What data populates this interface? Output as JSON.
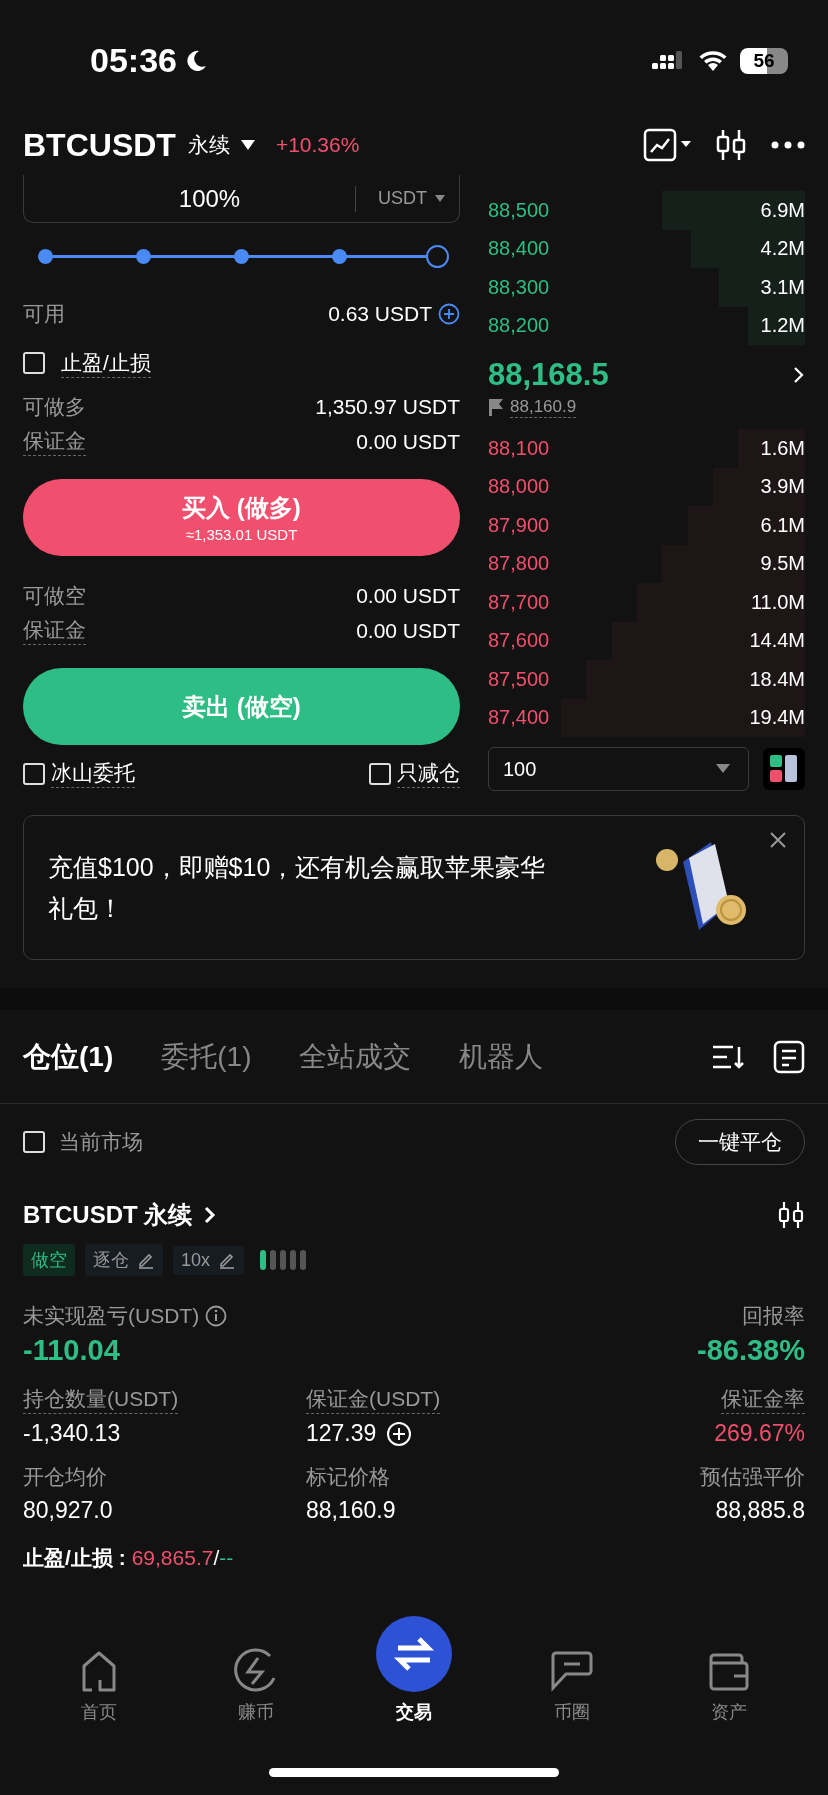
{
  "status_bar": {
    "time": "05:36",
    "battery": "56"
  },
  "header": {
    "symbol": "BTCUSDT",
    "contract": "永续",
    "change": "+10.36%"
  },
  "order_form": {
    "amount": {
      "value": "100%",
      "unit": "USDT"
    },
    "slider": {
      "level": 1
    },
    "available": {
      "label": "可用",
      "value": "0.63 USDT"
    },
    "tp_sl": {
      "label": "止盈/止损",
      "checked": false
    },
    "long_rows": [
      {
        "label": "可做多",
        "value": "1,350.97 USDT"
      },
      {
        "label": "保证金",
        "value": "0.00 USDT"
      }
    ],
    "buy_button": {
      "label": "买入 (做多)",
      "sub": "≈1,353.01 USDT"
    },
    "short_rows": [
      {
        "label": "可做空",
        "value": "0.00 USDT"
      },
      {
        "label": "保证金",
        "value": "0.00 USDT"
      }
    ],
    "sell_button": {
      "label": "卖出 (做空)"
    },
    "options": [
      {
        "label": "冰山委托",
        "checked": false
      },
      {
        "label": "只减仓",
        "checked": false
      }
    ]
  },
  "order_book": {
    "asks": [
      {
        "price": "88,500",
        "size": "6.9M"
      },
      {
        "price": "88,400",
        "size": "4.2M"
      },
      {
        "price": "88,300",
        "size": "3.1M"
      },
      {
        "price": "88,200",
        "size": "1.2M"
      }
    ],
    "last_price": "88,168.5",
    "mark_price": "88,160.9",
    "bids": [
      {
        "price": "88,100",
        "size": "1.6M"
      },
      {
        "price": "88,000",
        "size": "3.9M"
      },
      {
        "price": "87,900",
        "size": "6.1M"
      },
      {
        "price": "87,800",
        "size": "9.5M"
      },
      {
        "price": "87,700",
        "size": "11.0M"
      },
      {
        "price": "87,600",
        "size": "14.4M"
      },
      {
        "price": "87,500",
        "size": "18.4M"
      },
      {
        "price": "87,400",
        "size": "19.4M"
      }
    ],
    "depth": "100"
  },
  "banner": {
    "text": "充值$100，即赠$10，还有机会赢取苹果豪华礼包！"
  },
  "tabs": [
    {
      "label": "仓位(1)",
      "selected": true
    },
    {
      "label": "委托(1)",
      "selected": false
    },
    {
      "label": "全站成交",
      "selected": false
    },
    {
      "label": "机器人",
      "selected": false
    }
  ],
  "filter": {
    "label": "当前市场",
    "checked": false,
    "close_all": "一键平仓"
  },
  "position": {
    "symbol": "BTCUSDT 永续",
    "tags": [
      {
        "label": "做空",
        "kind": "side"
      },
      {
        "label": "逐仓",
        "kind": "edit"
      },
      {
        "label": "10x",
        "kind": "edit"
      }
    ],
    "pnl": {
      "label": "未实现盈亏(USDT)",
      "value": "-110.04",
      "color": "#2ebd85"
    },
    "roe": {
      "label": "回报率",
      "value": "-86.38%",
      "color": "#2ebd85"
    },
    "stats": [
      {
        "label": "持仓数量(USDT)",
        "value": "-1,340.13",
        "color": "#ffffff"
      },
      {
        "label": "保证金(USDT)",
        "value": "127.39",
        "color": "#ffffff",
        "kind": "add"
      },
      {
        "label": "保证金率",
        "value": "269.67%",
        "color": "#f0506e"
      },
      {
        "label": "开仓均价",
        "value": "80,927.0",
        "color": "#ffffff"
      },
      {
        "label": "标记价格",
        "value": "88,160.9",
        "color": "#ffffff"
      },
      {
        "label": "预估强平价",
        "value": "88,885.8",
        "color": "#ffffff"
      }
    ],
    "tp_sl": {
      "label": "止盈/止损 :",
      "parts": [
        {
          "text": "69,865.7",
          "color": "#f0506e"
        },
        {
          "text": "/",
          "color": "#ffffff"
        },
        {
          "text": "--",
          "color": "#2ebd85"
        }
      ]
    }
  },
  "nav": [
    {
      "label": "首页",
      "selected": false,
      "kind": "home"
    },
    {
      "label": "赚币",
      "selected": false,
      "kind": "earn"
    },
    {
      "label": "交易",
      "selected": true,
      "kind": "trade"
    },
    {
      "label": "币圈",
      "selected": false,
      "kind": "chat"
    },
    {
      "label": "资产",
      "selected": false,
      "kind": "wallet"
    }
  ]
}
